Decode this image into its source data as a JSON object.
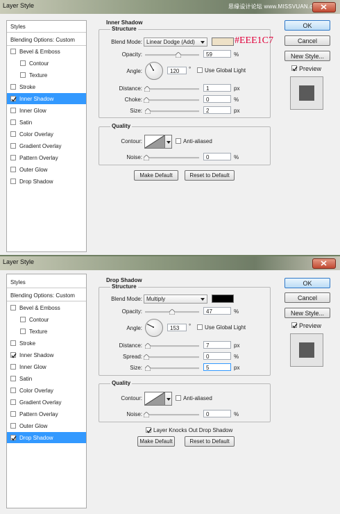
{
  "watermark": "思缘设计论坛 www.MISSVUAN.com",
  "annotation": "#EEE1C7",
  "dialogs": [
    {
      "title": "Layer Style",
      "styles_header": "Styles",
      "blending_options": "Blending Options: Custom",
      "style_items": [
        {
          "label": "Bevel & Emboss",
          "checked": false,
          "selected": false
        },
        {
          "label": "Contour",
          "checked": false,
          "selected": false
        },
        {
          "label": "Texture",
          "checked": false,
          "selected": false
        },
        {
          "label": "Stroke",
          "checked": false,
          "selected": false
        },
        {
          "label": "Inner Shadow",
          "checked": true,
          "selected": true
        },
        {
          "label": "Inner Glow",
          "checked": false,
          "selected": false
        },
        {
          "label": "Satin",
          "checked": false,
          "selected": false
        },
        {
          "label": "Color Overlay",
          "checked": false,
          "selected": false
        },
        {
          "label": "Gradient Overlay",
          "checked": false,
          "selected": false
        },
        {
          "label": "Pattern Overlay",
          "checked": false,
          "selected": false
        },
        {
          "label": "Outer Glow",
          "checked": false,
          "selected": false
        },
        {
          "label": "Drop Shadow",
          "checked": false,
          "selected": false
        }
      ],
      "section_title": "Inner Shadow",
      "structure": {
        "label": "Structure",
        "blend_mode_label": "Blend Mode:",
        "blend_mode": "Linear Dodge (Add)",
        "color": "#eee1c7",
        "opacity_label": "Opacity:",
        "opacity": "59",
        "opacity_fraction": 0.59,
        "angle_label": "Angle:",
        "angle": "120",
        "angle_deg": 120,
        "degree_sign": "°",
        "use_global_light": "Use Global Light",
        "use_global_light_checked": false,
        "param1_label": "Distance:",
        "param1": "1",
        "param1_unit": "px",
        "param1_fraction": 0.01,
        "param2_label": "Choke:",
        "param2": "0",
        "param2_unit": "%",
        "param2_fraction": 0.0,
        "param3_label": "Size:",
        "param3": "2",
        "param3_unit": "px",
        "param3_fraction": 0.02
      },
      "quality": {
        "label": "Quality",
        "contour_label": "Contour:",
        "anti_aliased": "Anti-aliased",
        "anti_aliased_checked": false,
        "noise_label": "Noise:",
        "noise": "0",
        "noise_unit": "%",
        "noise_fraction": 0.0
      },
      "knockout": null,
      "make_default": "Make Default",
      "reset_default": "Reset to Default",
      "ok": "OK",
      "cancel": "Cancel",
      "new_style": "New Style...",
      "preview": "Preview",
      "preview_checked": true,
      "percent": "%"
    },
    {
      "title": "Layer Style",
      "styles_header": "Styles",
      "blending_options": "Blending Options: Custom",
      "style_items": [
        {
          "label": "Bevel & Emboss",
          "checked": false,
          "selected": false
        },
        {
          "label": "Contour",
          "checked": false,
          "selected": false
        },
        {
          "label": "Texture",
          "checked": false,
          "selected": false
        },
        {
          "label": "Stroke",
          "checked": false,
          "selected": false
        },
        {
          "label": "Inner Shadow",
          "checked": true,
          "selected": false
        },
        {
          "label": "Inner Glow",
          "checked": false,
          "selected": false
        },
        {
          "label": "Satin",
          "checked": false,
          "selected": false
        },
        {
          "label": "Color Overlay",
          "checked": false,
          "selected": false
        },
        {
          "label": "Gradient Overlay",
          "checked": false,
          "selected": false
        },
        {
          "label": "Pattern Overlay",
          "checked": false,
          "selected": false
        },
        {
          "label": "Outer Glow",
          "checked": false,
          "selected": false
        },
        {
          "label": "Drop Shadow",
          "checked": true,
          "selected": true
        }
      ],
      "section_title": "Drop Shadow",
      "structure": {
        "label": "Structure",
        "blend_mode_label": "Blend Mode:",
        "blend_mode": "Multiply",
        "color": "#000000",
        "opacity_label": "Opacity:",
        "opacity": "47",
        "opacity_fraction": 0.47,
        "angle_label": "Angle:",
        "angle": "153",
        "angle_deg": 153,
        "degree_sign": "°",
        "use_global_light": "Use Global Light",
        "use_global_light_checked": false,
        "param1_label": "Distance:",
        "param1": "7",
        "param1_unit": "px",
        "param1_fraction": 0.03,
        "param2_label": "Spread:",
        "param2": "0",
        "param2_unit": "%",
        "param2_fraction": 0.0,
        "param3_label": "Size:",
        "param3": "5",
        "param3_unit": "px",
        "param3_fraction": 0.03
      },
      "quality": {
        "label": "Quality",
        "contour_label": "Contour:",
        "anti_aliased": "Anti-aliased",
        "anti_aliased_checked": false,
        "noise_label": "Noise:",
        "noise": "0",
        "noise_unit": "%",
        "noise_fraction": 0.0
      },
      "knockout": {
        "label": "Layer Knocks Out Drop Shadow",
        "checked": true
      },
      "make_default": "Make Default",
      "reset_default": "Reset to Default",
      "ok": "OK",
      "cancel": "Cancel",
      "new_style": "New Style...",
      "preview": "Preview",
      "preview_checked": true,
      "percent": "%"
    }
  ]
}
